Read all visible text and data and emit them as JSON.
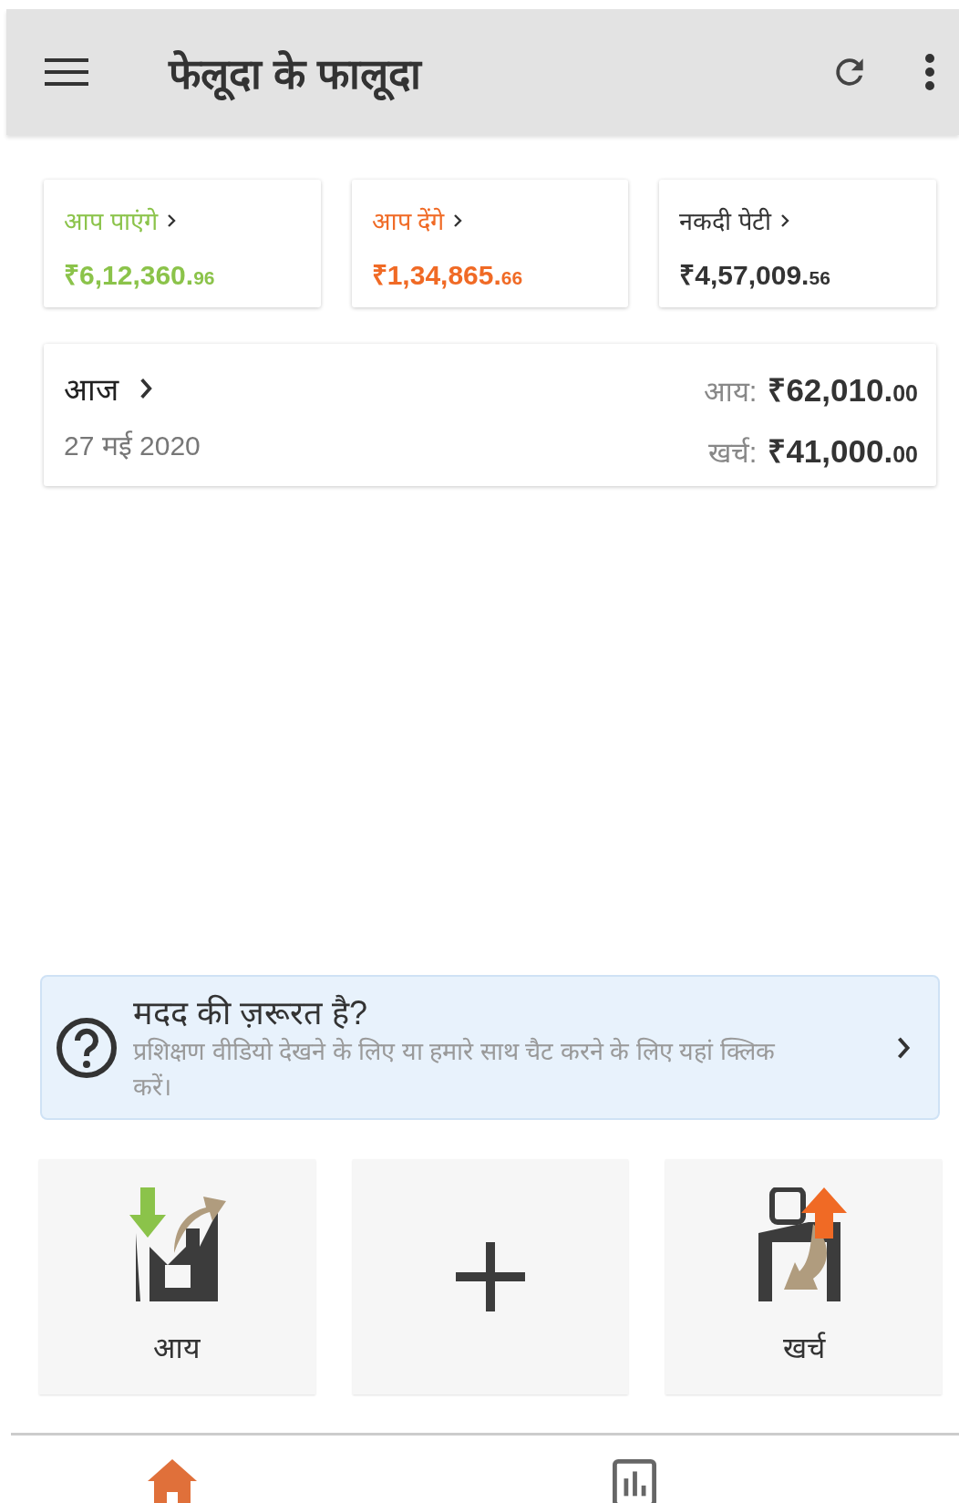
{
  "app_bar": {
    "title": "फेलूदा के फालूदा"
  },
  "summary_cards": [
    {
      "label": "आप पाएंगे",
      "amount": "₹6,12,360.",
      "fraction": "96",
      "color": "#8bc34a"
    },
    {
      "label": "आप देंगे",
      "amount": "₹1,34,865.",
      "fraction": "66",
      "color": "#f06a25"
    },
    {
      "label": "नकदी पेटी",
      "amount": "₹4,57,009.",
      "fraction": "56",
      "color": "#333333"
    }
  ],
  "today": {
    "title": "आज",
    "date": "27 मई 2020",
    "rows": [
      {
        "label": "आय:",
        "amount": "₹62,010.",
        "fraction": "00"
      },
      {
        "label": "खर्च:",
        "amount": "₹41,000.",
        "fraction": "00"
      }
    ]
  },
  "help_banner": {
    "title": "मदद की ज़रूरत है?",
    "text": "प्रशिक्षण वीडियो देखने के लिए या हमारे साथ चैट करने के लिए यहां क्लिक करें।"
  },
  "tiles": [
    {
      "kind": "income",
      "label": "आय"
    },
    {
      "kind": "add"
    },
    {
      "kind": "expense",
      "label": "खर्च"
    }
  ],
  "bottom_nav": [
    {
      "kind": "home",
      "selected": true
    },
    {
      "kind": "reports",
      "selected": false
    }
  ]
}
